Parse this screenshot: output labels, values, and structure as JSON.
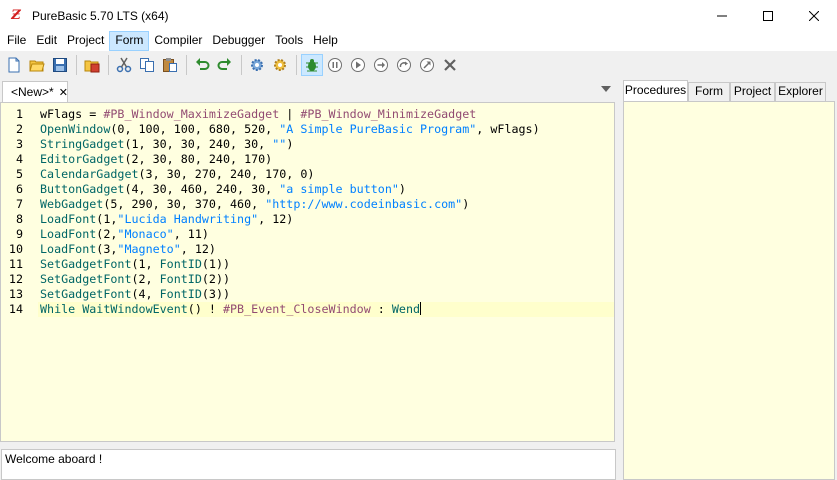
{
  "window": {
    "title": "PureBasic 5.70 LTS (x64)",
    "app_icon": "purebasic-logo-icon",
    "app_icon_glyph": "Ƶ",
    "controls": [
      "minimize-icon",
      "maximize-icon",
      "close-icon"
    ]
  },
  "menu": {
    "items": [
      "File",
      "Edit",
      "Project",
      "Form",
      "Compiler",
      "Debugger",
      "Tools",
      "Help"
    ],
    "active": "Form"
  },
  "toolbar": {
    "buttons": [
      "new-file-icon",
      "open-file-icon",
      "save-icon",
      "separator",
      "save-as-icon",
      "separator",
      "cut-icon",
      "copy-icon",
      "paste-icon",
      "separator",
      "undo-icon",
      "redo-icon",
      "separator",
      "compile-run-icon",
      "compiler-options-icon",
      "separator",
      "debugger-icon",
      "pause-icon",
      "continue-icon",
      "step-icon",
      "step-over-icon",
      "step-out-icon",
      "kill-program-icon"
    ]
  },
  "editor": {
    "tab_label": "<New>*",
    "tab_close": "✕",
    "line_numbers": [
      "1",
      "2",
      "3",
      "4",
      "5",
      "6",
      "7",
      "8",
      "9",
      "10",
      "11",
      "12",
      "13",
      "14"
    ],
    "current_line": 14,
    "lines": [
      [
        {
          "t": "wFlags = ",
          "c": "plain"
        },
        {
          "t": "#PB_Window_MaximizeGadget",
          "c": "const"
        },
        {
          "t": " | ",
          "c": "plain"
        },
        {
          "t": "#PB_Window_MinimizeGadget",
          "c": "const"
        }
      ],
      [
        {
          "t": "OpenWindow",
          "c": "kw"
        },
        {
          "t": "(0, 100, 100, 680, 520, ",
          "c": "plain"
        },
        {
          "t": "\"A Simple PureBasic Program\"",
          "c": "str"
        },
        {
          "t": ", wFlags)",
          "c": "plain"
        }
      ],
      [
        {
          "t": "StringGadget",
          "c": "kw"
        },
        {
          "t": "(1, 30, 30, 240, 30, ",
          "c": "plain"
        },
        {
          "t": "\"\"",
          "c": "str"
        },
        {
          "t": ")",
          "c": "plain"
        }
      ],
      [
        {
          "t": "EditorGadget",
          "c": "kw"
        },
        {
          "t": "(2, 30, 80, 240, 170)",
          "c": "plain"
        }
      ],
      [
        {
          "t": "CalendarGadget",
          "c": "kw"
        },
        {
          "t": "(3, 30, 270, 240, 170, 0)",
          "c": "plain"
        }
      ],
      [
        {
          "t": "ButtonGadget",
          "c": "kw"
        },
        {
          "t": "(4, 30, 460, 240, 30, ",
          "c": "plain"
        },
        {
          "t": "\"a simple button\"",
          "c": "str"
        },
        {
          "t": ")",
          "c": "plain"
        }
      ],
      [
        {
          "t": "WebGadget",
          "c": "kw"
        },
        {
          "t": "(5, 290, 30, 370, 460, ",
          "c": "plain"
        },
        {
          "t": "\"http://www.codeinbasic.com\"",
          "c": "str"
        },
        {
          "t": ")",
          "c": "plain"
        }
      ],
      [
        {
          "t": "LoadFont",
          "c": "kw"
        },
        {
          "t": "(1,",
          "c": "plain"
        },
        {
          "t": "\"Lucida Handwriting\"",
          "c": "str"
        },
        {
          "t": ", 12)",
          "c": "plain"
        }
      ],
      [
        {
          "t": "LoadFont",
          "c": "kw"
        },
        {
          "t": "(2,",
          "c": "plain"
        },
        {
          "t": "\"Monaco\"",
          "c": "str"
        },
        {
          "t": ", 11)",
          "c": "plain"
        }
      ],
      [
        {
          "t": "LoadFont",
          "c": "kw"
        },
        {
          "t": "(3,",
          "c": "plain"
        },
        {
          "t": "\"Magneto\"",
          "c": "str"
        },
        {
          "t": ", 12)",
          "c": "plain"
        }
      ],
      [
        {
          "t": "SetGadgetFont",
          "c": "kw"
        },
        {
          "t": "(1, ",
          "c": "plain"
        },
        {
          "t": "FontID",
          "c": "kw"
        },
        {
          "t": "(1))",
          "c": "plain"
        }
      ],
      [
        {
          "t": "SetGadgetFont",
          "c": "kw"
        },
        {
          "t": "(2, ",
          "c": "plain"
        },
        {
          "t": "FontID",
          "c": "kw"
        },
        {
          "t": "(2))",
          "c": "plain"
        }
      ],
      [
        {
          "t": "SetGadgetFont",
          "c": "kw"
        },
        {
          "t": "(4, ",
          "c": "plain"
        },
        {
          "t": "FontID",
          "c": "kw"
        },
        {
          "t": "(3))",
          "c": "plain"
        }
      ],
      [
        {
          "t": "While",
          "c": "ctl"
        },
        {
          "t": " ",
          "c": "plain"
        },
        {
          "t": "WaitWindowEvent",
          "c": "kw"
        },
        {
          "t": "() ! ",
          "c": "plain"
        },
        {
          "t": "#PB_Event_CloseWindow",
          "c": "const"
        },
        {
          "t": " : ",
          "c": "plain"
        },
        {
          "t": "Wend",
          "c": "ctl"
        }
      ]
    ]
  },
  "log": {
    "message": "Welcome aboard !"
  },
  "right_panel": {
    "tabs": [
      "Procedures",
      "Form",
      "Project",
      "Explorer"
    ],
    "active_tab": "Procedures"
  },
  "colors": {
    "editor_bg": "#ffffe0",
    "keyword": "#006666",
    "constant": "#924b72",
    "string": "#0080ff",
    "menu_highlight": "#cce8ff"
  }
}
